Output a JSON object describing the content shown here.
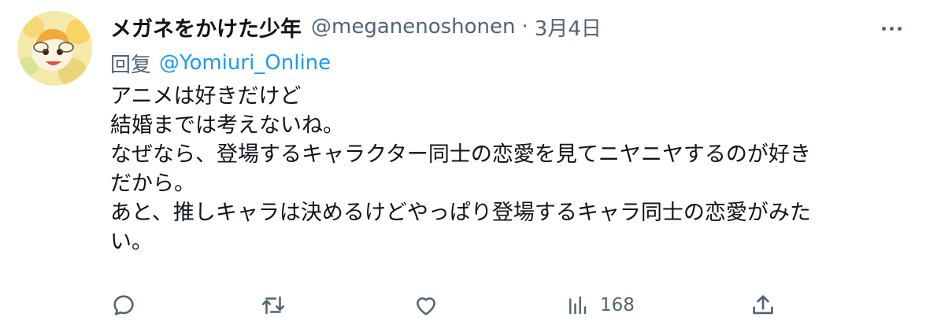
{
  "user": {
    "display_name": "メガネをかけた少年",
    "handle": "@meganenoshonen",
    "separator": "·",
    "date": "3月4日"
  },
  "reply": {
    "prefix": "回复",
    "target": "@Yomiuri_Online"
  },
  "body_lines": [
    "アニメは好きだけど",
    "結婚までは考えないね。",
    "なぜなら、登場するキャラクター同士の恋愛を見てニヤニヤするのが好き",
    "だから。",
    "あと、推しキャラは決めるけどやっぱり登場するキャラ同士の恋愛がみた",
    "い。"
  ],
  "actions": {
    "reply_icon": "comment-bubble-icon",
    "retweet_icon": "retweet-icon",
    "like_icon": "heart-icon",
    "views_icon": "bar-chart-icon",
    "views_count": "168",
    "share_icon": "share-upload-icon"
  },
  "colors": {
    "text_primary": "#0f1419",
    "text_secondary": "#536471",
    "link": "#1d9bf0"
  }
}
